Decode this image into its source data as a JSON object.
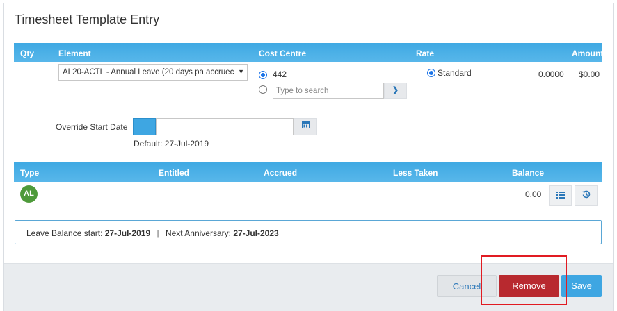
{
  "dialog": {
    "title": "Timesheet Template Entry"
  },
  "entry_header": {
    "qty": "Qty",
    "element": "Element",
    "cost_centre": "Cost Centre",
    "rate": "Rate",
    "amount": "Amount"
  },
  "entry_row": {
    "element_selected": "AL20-ACTL - Annual Leave (20 days pa accruec",
    "cost_centre_option": "442",
    "cost_centre_search_placeholder": "Type to search",
    "rate_option": "Standard",
    "rate_value": "0.0000",
    "amount_value": "$0.00"
  },
  "override": {
    "label": "Override Start Date",
    "default_text": "Default: 27-Jul-2019",
    "value": ""
  },
  "balance_header": {
    "type": "Type",
    "entitled": "Entitled",
    "accrued": "Accrued",
    "less_taken": "Less Taken",
    "balance": "Balance"
  },
  "balance_row": {
    "type_badge": "AL",
    "balance": "0.00"
  },
  "info": {
    "leave_balance_label": "Leave Balance start:",
    "leave_balance_value": "27-Jul-2019",
    "separator": "|",
    "anniversary_label": "Next Anniversary:",
    "anniversary_value": "27-Jul-2023"
  },
  "footer": {
    "cancel_label": "Cancel",
    "remove_label": "Remove",
    "save_label": "Save"
  },
  "icons": {
    "select_chevron": "chevron-down-icon",
    "search_chevron": "chevron-down-icon",
    "calendar": "calendar-icon",
    "list": "list-icon",
    "history": "history-icon"
  },
  "colors": {
    "header_bar": "#4aafe6",
    "remove_button": "#b8292f",
    "save_button": "#3ea6e2",
    "badge_green": "#4e9a3a",
    "highlight": "#e11b22"
  }
}
